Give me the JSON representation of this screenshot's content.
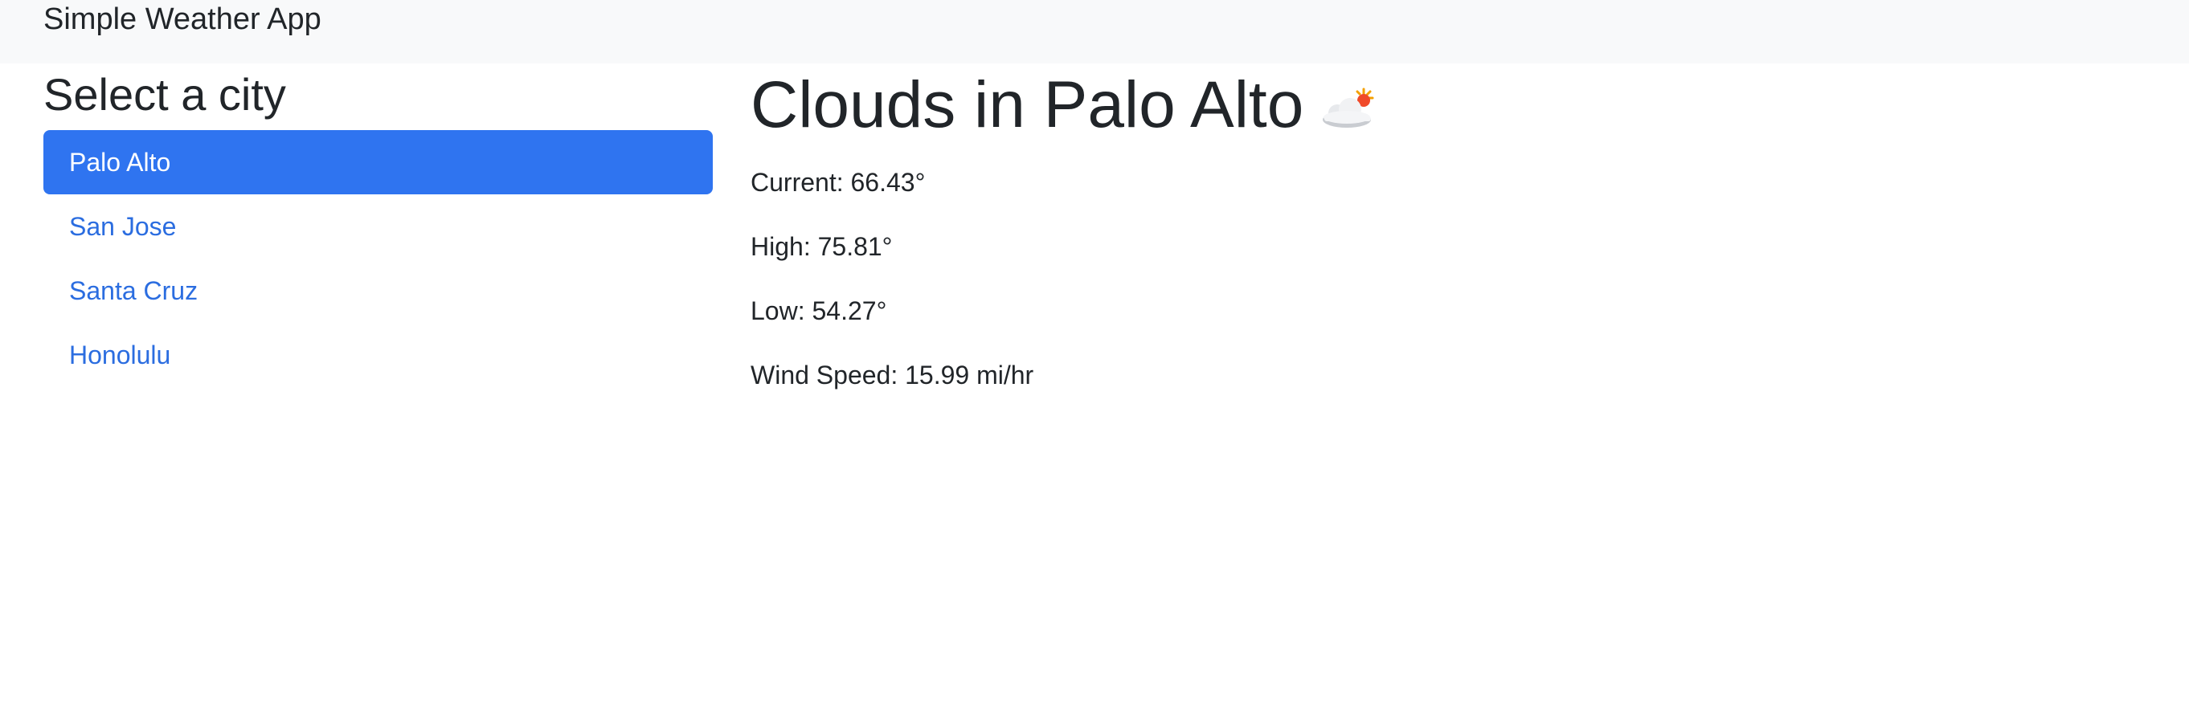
{
  "navbar": {
    "brand": "Simple Weather App"
  },
  "sidebar": {
    "title": "Select a city",
    "cities": [
      {
        "label": "Palo Alto",
        "active": true
      },
      {
        "label": "San Jose",
        "active": false
      },
      {
        "label": "Santa Cruz",
        "active": false
      },
      {
        "label": "Honolulu",
        "active": false
      }
    ]
  },
  "main": {
    "title": "Clouds in Palo Alto",
    "icon": "cloud-with-sun-icon",
    "current": "Current: 66.43°",
    "high": "High: 75.81°",
    "low": "Low: 54.27°",
    "wind": "Wind Speed: 15.99 mi/hr"
  },
  "colors": {
    "accent": "#2f74f0",
    "link": "#2b6de0",
    "navbar_bg": "#f8f9fa",
    "text": "#212529"
  }
}
